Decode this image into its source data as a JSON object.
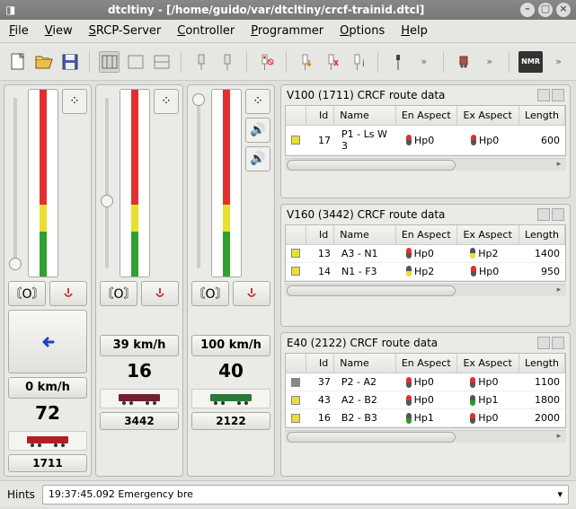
{
  "window": {
    "title": "dtcltiny - [/home/guido/var/dtcltiny/crcf-trainid.dtcl]"
  },
  "menu": {
    "file": "File",
    "view": "View",
    "srcp": "SRCP-Server",
    "controller": "Controller",
    "programmer": "Programmer",
    "options": "Options",
    "help": "Help"
  },
  "ctrl": [
    {
      "speed": "0 km/h",
      "num": "72",
      "id": "1711",
      "thumb": 188,
      "color": "#b02020"
    },
    {
      "speed": "39 km/h",
      "num": "16",
      "id": "3442",
      "thumb": 118,
      "color": "#702030"
    },
    {
      "speed": "100 km/h",
      "num": "40",
      "id": "2122",
      "thumb": 5,
      "color": "#2a7a3a"
    }
  ],
  "panels": [
    {
      "title": "V100 (1711) CRCF route data",
      "cols": [
        "",
        "Id",
        "Name",
        "En Aspect",
        "Ex Aspect",
        "Length"
      ],
      "rows": [
        {
          "sq": "#e8e030",
          "id": "17",
          "name": "P1 - Ls W 3",
          "en": "Hp0",
          "enc": [
            "#e03030",
            "#555"
          ],
          "ex": "Hp0",
          "exc": [
            "#e03030",
            "#555"
          ],
          "len": "600"
        }
      ]
    },
    {
      "title": "V160 (3442) CRCF route data",
      "cols": [
        "",
        "Id",
        "Name",
        "En Aspect",
        "Ex Aspect",
        "Length"
      ],
      "rows": [
        {
          "sq": "#e8e030",
          "id": "13",
          "name": "A3 - N1",
          "en": "Hp0",
          "enc": [
            "#e03030",
            "#555"
          ],
          "ex": "Hp2",
          "exc": [
            "#555",
            "#e8e030"
          ],
          "len": "1400"
        },
        {
          "sq": "#e8e030",
          "id": "14",
          "name": "N1 - F3",
          "en": "Hp2",
          "enc": [
            "#555",
            "#e8e030"
          ],
          "ex": "Hp0",
          "exc": [
            "#e03030",
            "#555"
          ],
          "len": "950"
        }
      ]
    },
    {
      "title": "E40 (2122) CRCF route data",
      "cols": [
        "",
        "Id",
        "Name",
        "En Aspect",
        "Ex Aspect",
        "Length"
      ],
      "rows": [
        {
          "sq": "#888",
          "id": "37",
          "name": "P2 - A2",
          "en": "Hp0",
          "enc": [
            "#e03030",
            "#555"
          ],
          "ex": "Hp0",
          "exc": [
            "#e03030",
            "#555"
          ],
          "len": "1100"
        },
        {
          "sq": "#e8e030",
          "id": "43",
          "name": "A2 - B2",
          "en": "Hp0",
          "enc": [
            "#e03030",
            "#555"
          ],
          "ex": "Hp1",
          "exc": [
            "#555",
            "#2a9a2a"
          ],
          "len": "1800"
        },
        {
          "sq": "#e8e030",
          "id": "16",
          "name": "B2 - B3",
          "en": "Hp1",
          "enc": [
            "#555",
            "#2a9a2a"
          ],
          "ex": "Hp0",
          "exc": [
            "#e03030",
            "#555"
          ],
          "len": "2000"
        }
      ]
    }
  ],
  "status": {
    "hints": "Hints",
    "log": "19:37:45.092 Emergency bre"
  }
}
